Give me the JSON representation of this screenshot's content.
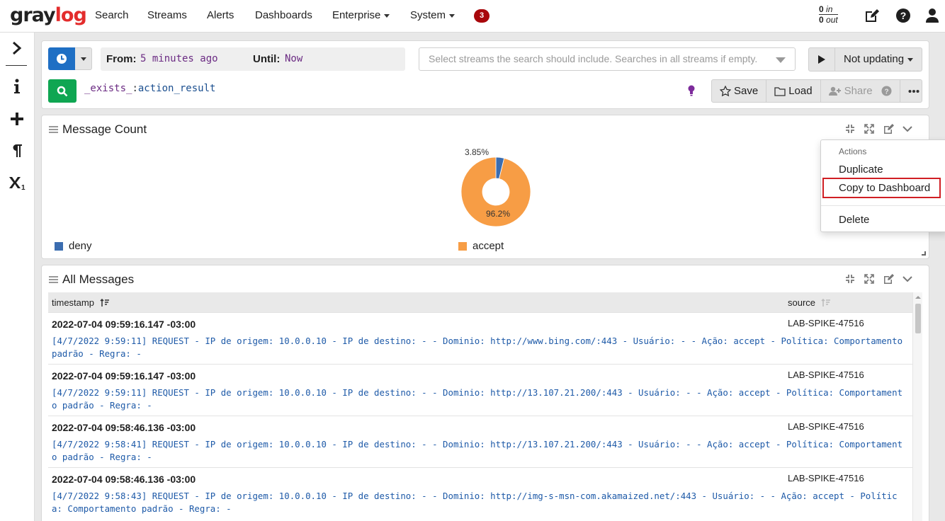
{
  "app": {
    "logo_part1": "gray",
    "logo_part2": "log"
  },
  "nav": {
    "items": [
      {
        "label": "Search"
      },
      {
        "label": "Streams"
      },
      {
        "label": "Alerts"
      },
      {
        "label": "Dashboards"
      },
      {
        "label": "Enterprise"
      },
      {
        "label": "System"
      }
    ],
    "notifications_count": "3",
    "throughput": {
      "in_value": "0",
      "in_unit": "in",
      "out_value": "0",
      "out_unit": "out"
    }
  },
  "search": {
    "from_label": "From:",
    "from_value": "5 minutes ago",
    "until_label": "Until:",
    "until_value": "Now",
    "streams_placeholder": "Select streams the search should include. Searches in all streams if empty.",
    "refresh_label": "Not updating",
    "query_key": "_exists_",
    "query_sep": ":",
    "query_value": "action_result",
    "actions": {
      "save": "Save",
      "load": "Load",
      "share": "Share"
    }
  },
  "message_count_widget": {
    "title": "Message Count",
    "pie_labels": {
      "small": "3.85%",
      "large": "96.2%"
    }
  },
  "widget_menu": {
    "header": "Actions",
    "items": [
      "Duplicate",
      "Copy to Dashboard",
      "Delete"
    ]
  },
  "all_messages_widget": {
    "title": "All Messages",
    "columns": {
      "timestamp": "timestamp",
      "source": "source"
    },
    "rows": [
      {
        "timestamp": "2022-07-04 09:59:16.147 -03:00",
        "source": "LAB-SPIKE-47516",
        "message": "[4/7/2022 9:59:11] REQUEST - IP de origem: 10.0.0.10 - IP de destino: - - Dominio: http://www.bing.com/:443 - Usuário: - - Ação: accept - Política: Comportamento padrão - Regra: -"
      },
      {
        "timestamp": "2022-07-04 09:59:16.147 -03:00",
        "source": "LAB-SPIKE-47516",
        "message": "[4/7/2022 9:59:11] REQUEST - IP de origem: 10.0.0.10 - IP de destino: - - Dominio: http://13.107.21.200/:443 - Usuário: - - Ação: accept - Política: Comportamento padrão - Regra: -"
      },
      {
        "timestamp": "2022-07-04 09:58:46.136 -03:00",
        "source": "LAB-SPIKE-47516",
        "message": "[4/7/2022 9:58:41] REQUEST - IP de origem: 10.0.0.10 - IP de destino: - - Dominio: http://13.107.21.200/:443 - Usuário: - - Ação: accept - Política: Comportamento padrão - Regra: -"
      },
      {
        "timestamp": "2022-07-04 09:58:46.136 -03:00",
        "source": "LAB-SPIKE-47516",
        "message": "[4/7/2022 9:58:43] REQUEST - IP de origem: 10.0.0.10 - IP de destino: - - Dominio: http://img-s-msn-com.akamaized.net/:443 - Usuário: - - Ação: accept - Política: Comportamento padrão - Regra: -"
      }
    ]
  },
  "chart_data": {
    "type": "pie",
    "categories": [
      "deny",
      "accept"
    ],
    "values": [
      3.85,
      96.2
    ],
    "colors": [
      "#3b6db0",
      "#f79d45"
    ],
    "title": "Message Count"
  }
}
